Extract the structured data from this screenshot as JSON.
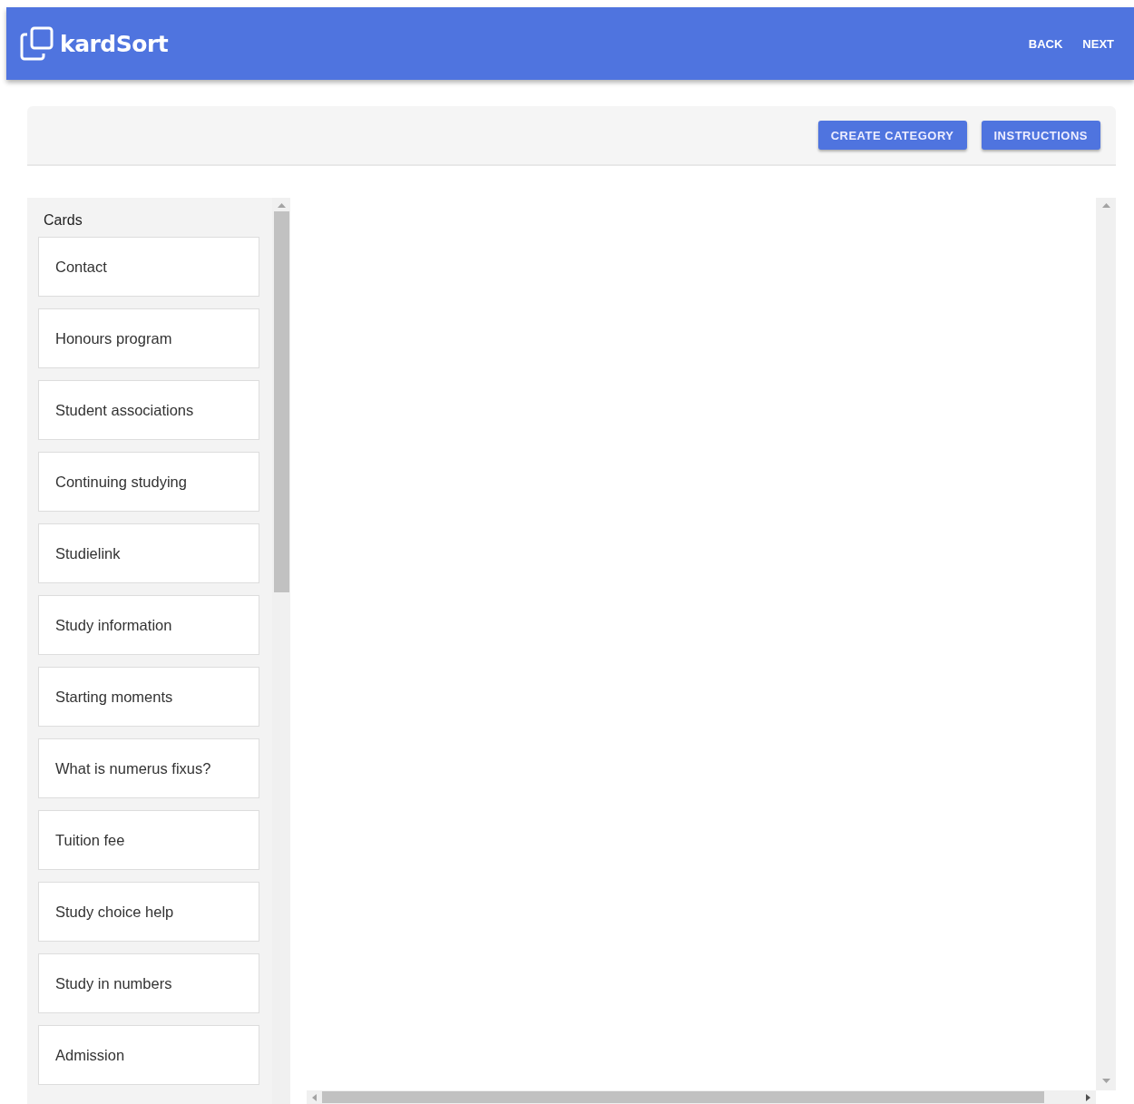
{
  "header": {
    "logo": "kardSort",
    "nav": [
      "BACK",
      "NEXT"
    ]
  },
  "toolbar": {
    "buttons": [
      "CREATE CATEGORY",
      "INSTRUCTIONS"
    ]
  },
  "cards_panel": {
    "title": "Cards",
    "cards": [
      "Contact",
      "Honours program",
      "Student associations",
      "Continuing studying",
      "Studielink",
      "Study information",
      "Starting moments",
      "What is numerus fixus?",
      "Tuition fee",
      "Study choice help",
      "Study in numbers",
      "Admission"
    ]
  }
}
